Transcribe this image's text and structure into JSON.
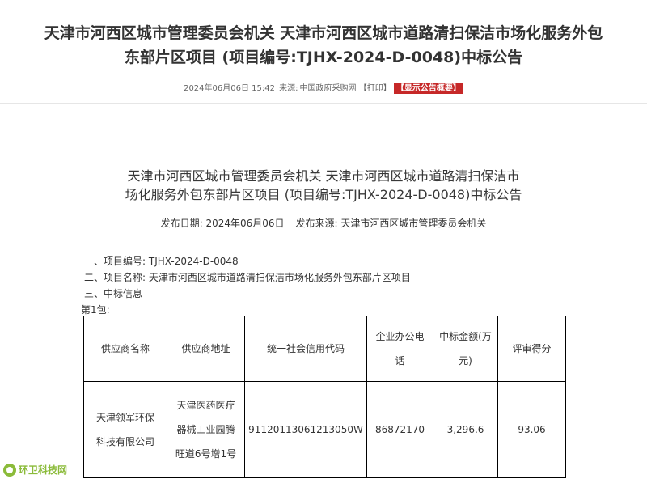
{
  "page_title": {
    "line1": "天津市河西区城市管理委员会机关 天津市河西区城市道路清扫保洁市场化服务外包",
    "line2": "东部片区项目 (项目编号:TJHX-2024-D-0048)中标公告"
  },
  "meta": {
    "datetime": "2024年06月06日 15:42",
    "source_label": "来源:",
    "source": "中国政府采购网",
    "print": "【打印】",
    "summary": "【显示公告概要】"
  },
  "doc": {
    "title_line1": "天津市河西区城市管理委员会机关 天津市河西区城市道路清扫保洁市",
    "title_line2": "场化服务外包东部片区项目 (项目编号:TJHX-2024-D-0048)中标公告",
    "publish_date": "发布日期: 2024年06月06日",
    "publish_source": "发布来源: 天津市河西区城市管理委员会机关",
    "items": [
      "一、项目编号: TJHX-2024-D-0048",
      "二、项目名称: 天津市河西区城市道路清扫保洁市场化服务外包东部片区项目",
      "三、中标信息"
    ],
    "package": "第1包:"
  },
  "table": {
    "headers": [
      {
        "lines": [
          "供应商名称"
        ]
      },
      {
        "lines": [
          "供应商地址"
        ]
      },
      {
        "lines": [
          "统一社会信用代码"
        ]
      },
      {
        "lines": [
          "企业办公电",
          "话"
        ]
      },
      {
        "lines": [
          "中标金额(万",
          "元)"
        ]
      },
      {
        "lines": [
          "评审得分"
        ]
      }
    ],
    "row": [
      {
        "lines": [
          "天津领军环保",
          "科技有限公司"
        ]
      },
      {
        "lines": [
          "天津医药医疗",
          "器械工业园腾",
          "旺道6号增1号"
        ]
      },
      {
        "lines": [
          "91120113061213050W"
        ]
      },
      {
        "lines": [
          "86872170"
        ]
      },
      {
        "lines": [
          "3,296.6"
        ]
      },
      {
        "lines": [
          "93.06"
        ]
      }
    ]
  },
  "watermark": "环卫科技网"
}
